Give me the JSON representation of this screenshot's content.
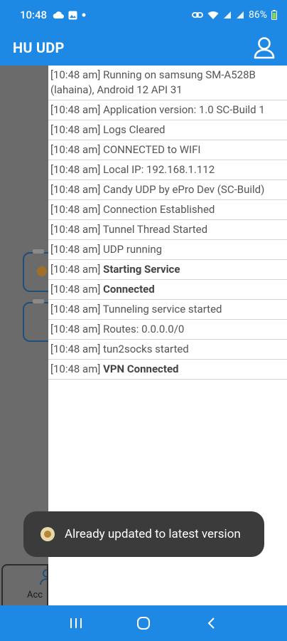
{
  "status_bar": {
    "time": "10:48",
    "left_icons": [
      "cloud-icon",
      "image-icon",
      "dot-icon"
    ],
    "right_icons": [
      "link-icon",
      "wifi-icon",
      "signal-icon",
      "signal-icon"
    ],
    "battery": "86%"
  },
  "app_bar": {
    "title": "HU UDP",
    "profile_icon": "person-icon"
  },
  "background": {
    "account_label": "Acc"
  },
  "logs": [
    {
      "stamp": "[10:48 am]",
      "message": "Running on samsung SM-A528B (lahaina), Android 12 API 31",
      "bold": false
    },
    {
      "stamp": "[10:48 am]",
      "message": "Application version: 1.0 SC-Build 1",
      "bold": false
    },
    {
      "stamp": "[10:48 am]",
      "message": "Logs Cleared",
      "bold": false
    },
    {
      "stamp": "[10:48 am]",
      "message": "CONNECTED to WIFI",
      "bold": false
    },
    {
      "stamp": "[10:48 am]",
      "message": "Local IP: 192.168.1.112",
      "bold": false
    },
    {
      "stamp": "[10:48 am]",
      "message": "Candy UDP by ePro Dev (SC-Build)",
      "bold": false
    },
    {
      "stamp": "[10:48 am]",
      "message": "Connection Established",
      "bold": false
    },
    {
      "stamp": "[10:48 am]",
      "message": "Tunnel Thread Started",
      "bold": false
    },
    {
      "stamp": "[10:48 am]",
      "message": "UDP running",
      "bold": false
    },
    {
      "stamp": "[10:48 am]",
      "message": "Starting Service",
      "bold": true
    },
    {
      "stamp": "[10:48 am]",
      "message": "Connected",
      "bold": true
    },
    {
      "stamp": "[10:48 am]",
      "message": "Tunneling service started",
      "bold": false
    },
    {
      "stamp": "[10:48 am]",
      "message": "Routes: 0.0.0.0/0",
      "bold": false
    },
    {
      "stamp": "[10:48 am]",
      "message": "tun2socks started",
      "bold": false
    },
    {
      "stamp": "[10:48 am]",
      "message": "VPN Connected",
      "bold": true
    }
  ],
  "toast": {
    "message": "Already updated to latest version"
  },
  "nav_bar": {
    "buttons": [
      "recents-icon",
      "home-icon",
      "back-icon"
    ]
  },
  "colors": {
    "primary": "#1e88e5",
    "toast_bg": "#3b3b3b",
    "scrim": "#6e6e6e"
  }
}
